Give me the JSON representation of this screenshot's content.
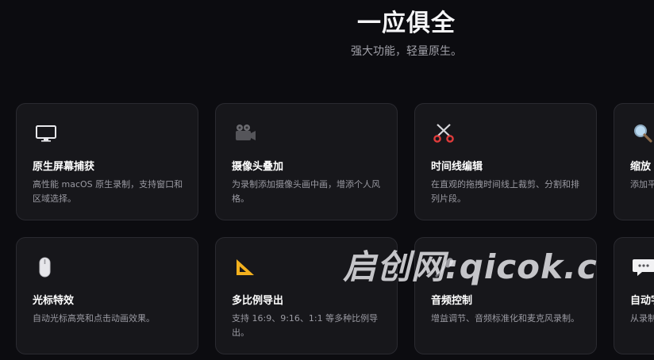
{
  "section": {
    "title": "一应俱全",
    "subtitle": "强大功能，轻量原生。"
  },
  "cards": [
    {
      "icon": "monitor-icon",
      "title": "原生屏幕捕获",
      "desc": "高性能 macOS 原生录制，支持窗口和区域选择。"
    },
    {
      "icon": "movie-camera-icon",
      "title": "摄像头叠加",
      "desc": "为录制添加摄像头画中画，增添个人风格。"
    },
    {
      "icon": "scissors-icon",
      "title": "时间线编辑",
      "desc": "在直观的拖拽时间线上裁剪、分割和排列片段。"
    },
    {
      "icon": "magnifier-icon",
      "title": "缩放",
      "desc": "添加平滑的缩放效果，突出关键时刻。"
    },
    {
      "icon": "mouse-icon",
      "title": "光标特效",
      "desc": "自动光标高亮和点击动画效果。"
    },
    {
      "icon": "triangle-ruler-icon",
      "title": "多比例导出",
      "desc": "支持 16:9、9:16、1:1 等多种比例导出。"
    },
    {
      "icon": "microphone-icon",
      "title": "音频控制",
      "desc": "增益调节、音频标准化和麦克风录制。"
    },
    {
      "icon": "speech-bubble-icon",
      "title": "自动字幕",
      "desc": "从录制中自动生成字幕。"
    }
  ],
  "watermark": "启创网:qicok.c"
}
